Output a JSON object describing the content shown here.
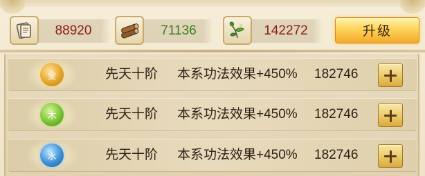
{
  "resources": [
    {
      "icon": "scroll-icon",
      "value": "88920",
      "color": "#8b1c17"
    },
    {
      "icon": "wood-logs-icon",
      "value": "71136",
      "color": "#3f7d1c"
    },
    {
      "icon": "herb-leaf-icon",
      "value": "142272",
      "color": "#8b1c17"
    }
  ],
  "upgrade_label": "升级",
  "rows": [
    {
      "element": "金",
      "element_color": "#e3a52d",
      "rank": "先天十阶",
      "effect": "本系功法效果+450%",
      "cost": "182746"
    },
    {
      "element": "木",
      "element_color": "#79c234",
      "rank": "先天十阶",
      "effect": "本系功法效果+450%",
      "cost": "182746"
    },
    {
      "element": "水",
      "element_color": "#3c8fd6",
      "rank": "先天十阶",
      "effect": "本系功法效果+450%",
      "cost": "182746"
    }
  ]
}
